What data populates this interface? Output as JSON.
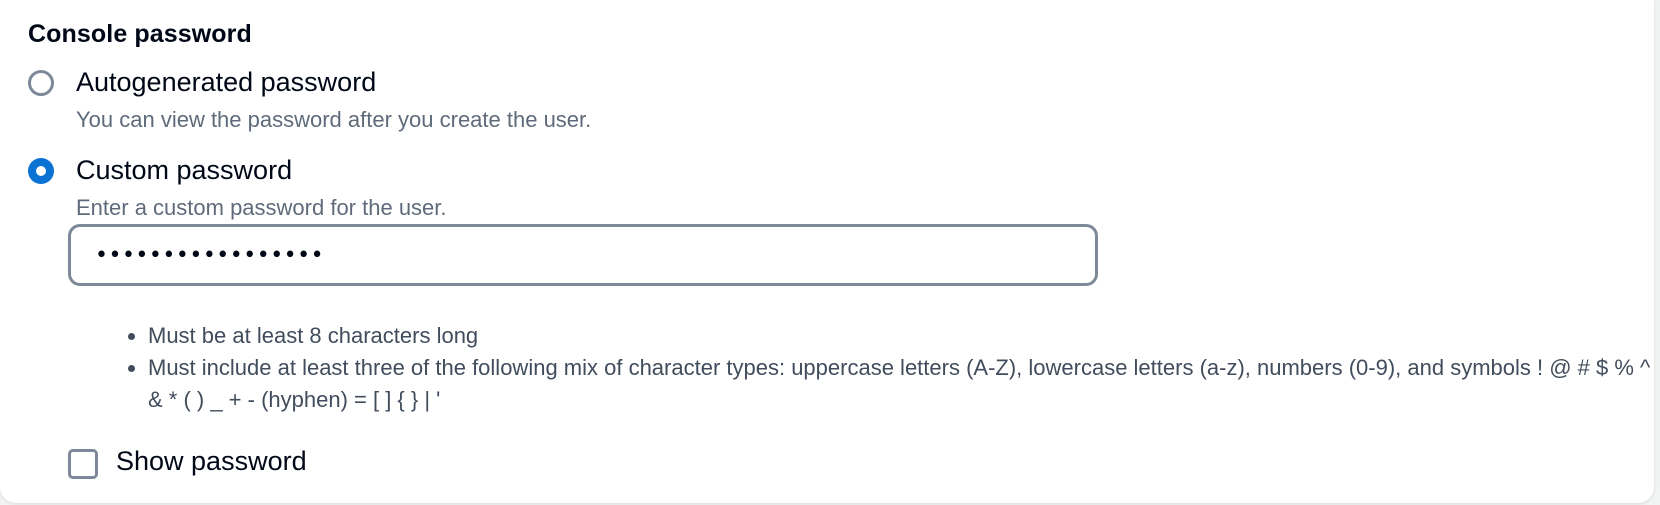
{
  "section": {
    "title": "Console password"
  },
  "options": {
    "autogenerated": {
      "label": "Autogenerated password",
      "description": "You can view the password after you create the user.",
      "selected": false
    },
    "custom": {
      "label": "Custom password",
      "description": "Enter a custom password for the user.",
      "selected": true
    }
  },
  "password_field": {
    "value": "•••••••••••••••••"
  },
  "requirements": [
    "Must be at least 8 characters long",
    "Must include at least three of the following mix of character types: uppercase letters (A-Z), lowercase letters (a-z), numbers (0-9), and symbols ! @ # $ % ^ & * ( ) _ + - (hyphen) = [ ] { } | '"
  ],
  "show_password": {
    "label": "Show password",
    "checked": false
  },
  "colors": {
    "accent": "#0972d3",
    "border": "#7d8998",
    "text": "#000716",
    "secondary_text": "#5f6b7a"
  }
}
